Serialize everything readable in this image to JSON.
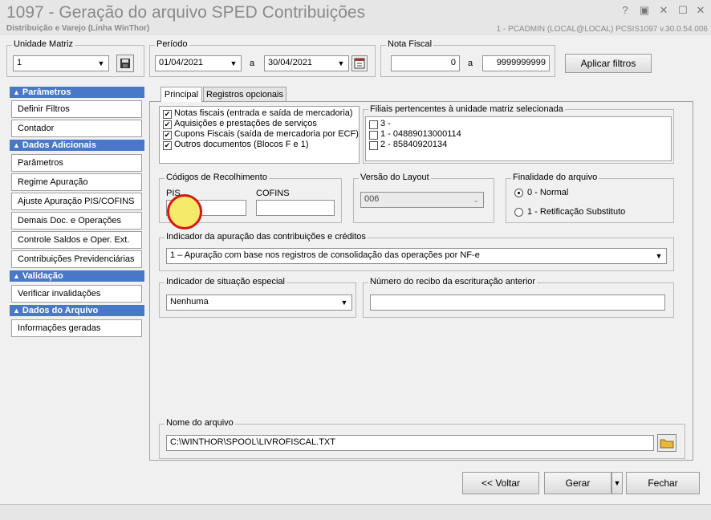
{
  "window": {
    "title": "1097 - Geração do arquivo SPED Contribuições",
    "subtitle": "Distribuição e Varejo (Linha WinThor)",
    "session": "1 - PCADMIN (LOCAL@LOCAL)  PCSIS1097  v.30.0.54.006",
    "controls": [
      "?",
      "▣",
      "✕",
      "☐",
      "✕"
    ]
  },
  "unidade": {
    "label": "Unidade Matriz",
    "value": "1"
  },
  "periodo": {
    "label": "Período",
    "start": "01/04/2021",
    "sep": "a",
    "end": "30/04/2021"
  },
  "nota_fiscal": {
    "label": "Nota Fiscal",
    "start": "0",
    "sep": "a",
    "end": "9999999999"
  },
  "apply_filters": "Aplicar filtros",
  "sidebar": {
    "sections": [
      {
        "title": "Parâmetros",
        "items": [
          "Definir Filtros",
          "Contador"
        ]
      },
      {
        "title": "Dados Adicionais",
        "items": [
          "Parâmetros",
          "Regime Apuração",
          "Ajuste Apuração PIS/COFINS",
          "Demais Doc. e Operações",
          "Controle Saldos e Oper. Ext.",
          "Contribuições Previdenciárias"
        ]
      },
      {
        "title": "Validação",
        "items": [
          "Verificar invalidações"
        ]
      },
      {
        "title": "Dados do Arquivo",
        "items": [
          "Informações geradas"
        ]
      }
    ]
  },
  "tabs": [
    "Principal",
    "Registros opcionais"
  ],
  "checks": [
    {
      "label": "Notas fiscais (entrada e saída de mercadoria)",
      "checked": true
    },
    {
      "label": "Aquisições e prestações de serviços",
      "checked": true
    },
    {
      "label": "Cupons Fiscais (saída de mercadoria por ECF)",
      "checked": true
    },
    {
      "label": "Outros documentos (Blocos F e 1)",
      "checked": true
    }
  ],
  "filiais": {
    "label": "Filiais pertencentes à unidade matriz selecionada",
    "items": [
      "3 -",
      "1 - 04889013000114",
      "2 - 85840920134"
    ]
  },
  "codigos": {
    "label": "Códigos de Recolhimento",
    "pis_label": "PIS",
    "pis_value": "",
    "cofins_label": "COFINS",
    "cofins_value": ""
  },
  "versao": {
    "label": "Versão do Layout",
    "value": "006"
  },
  "finalidade": {
    "label": "Finalidade do arquivo",
    "opt1": "0 - Normal",
    "opt2": "1 - Retificação Substituto",
    "selected": 0
  },
  "indicador_apuracao": {
    "label": "Indicador da apuração das contribuições e créditos",
    "value": "1 – Apuração com base nos registros de consolidação das operações por NF-e"
  },
  "indicador_situacao": {
    "label": "Indicador de situação especial",
    "value": "Nenhuma"
  },
  "recibo": {
    "label": "Número do recibo da escrituração anterior",
    "value": ""
  },
  "arquivo": {
    "label": "Nome do arquivo",
    "value": "C:\\WINTHOR\\SPOOL\\LIVROFISCAL.TXT"
  },
  "buttons": {
    "voltar": "<< Voltar",
    "gerar": "Gerar",
    "fechar": "Fechar"
  },
  "icons": {
    "save": "save-icon",
    "calendar": "calendar-icon",
    "folder": "folder-icon",
    "dropdown": "chevron-down-icon"
  }
}
